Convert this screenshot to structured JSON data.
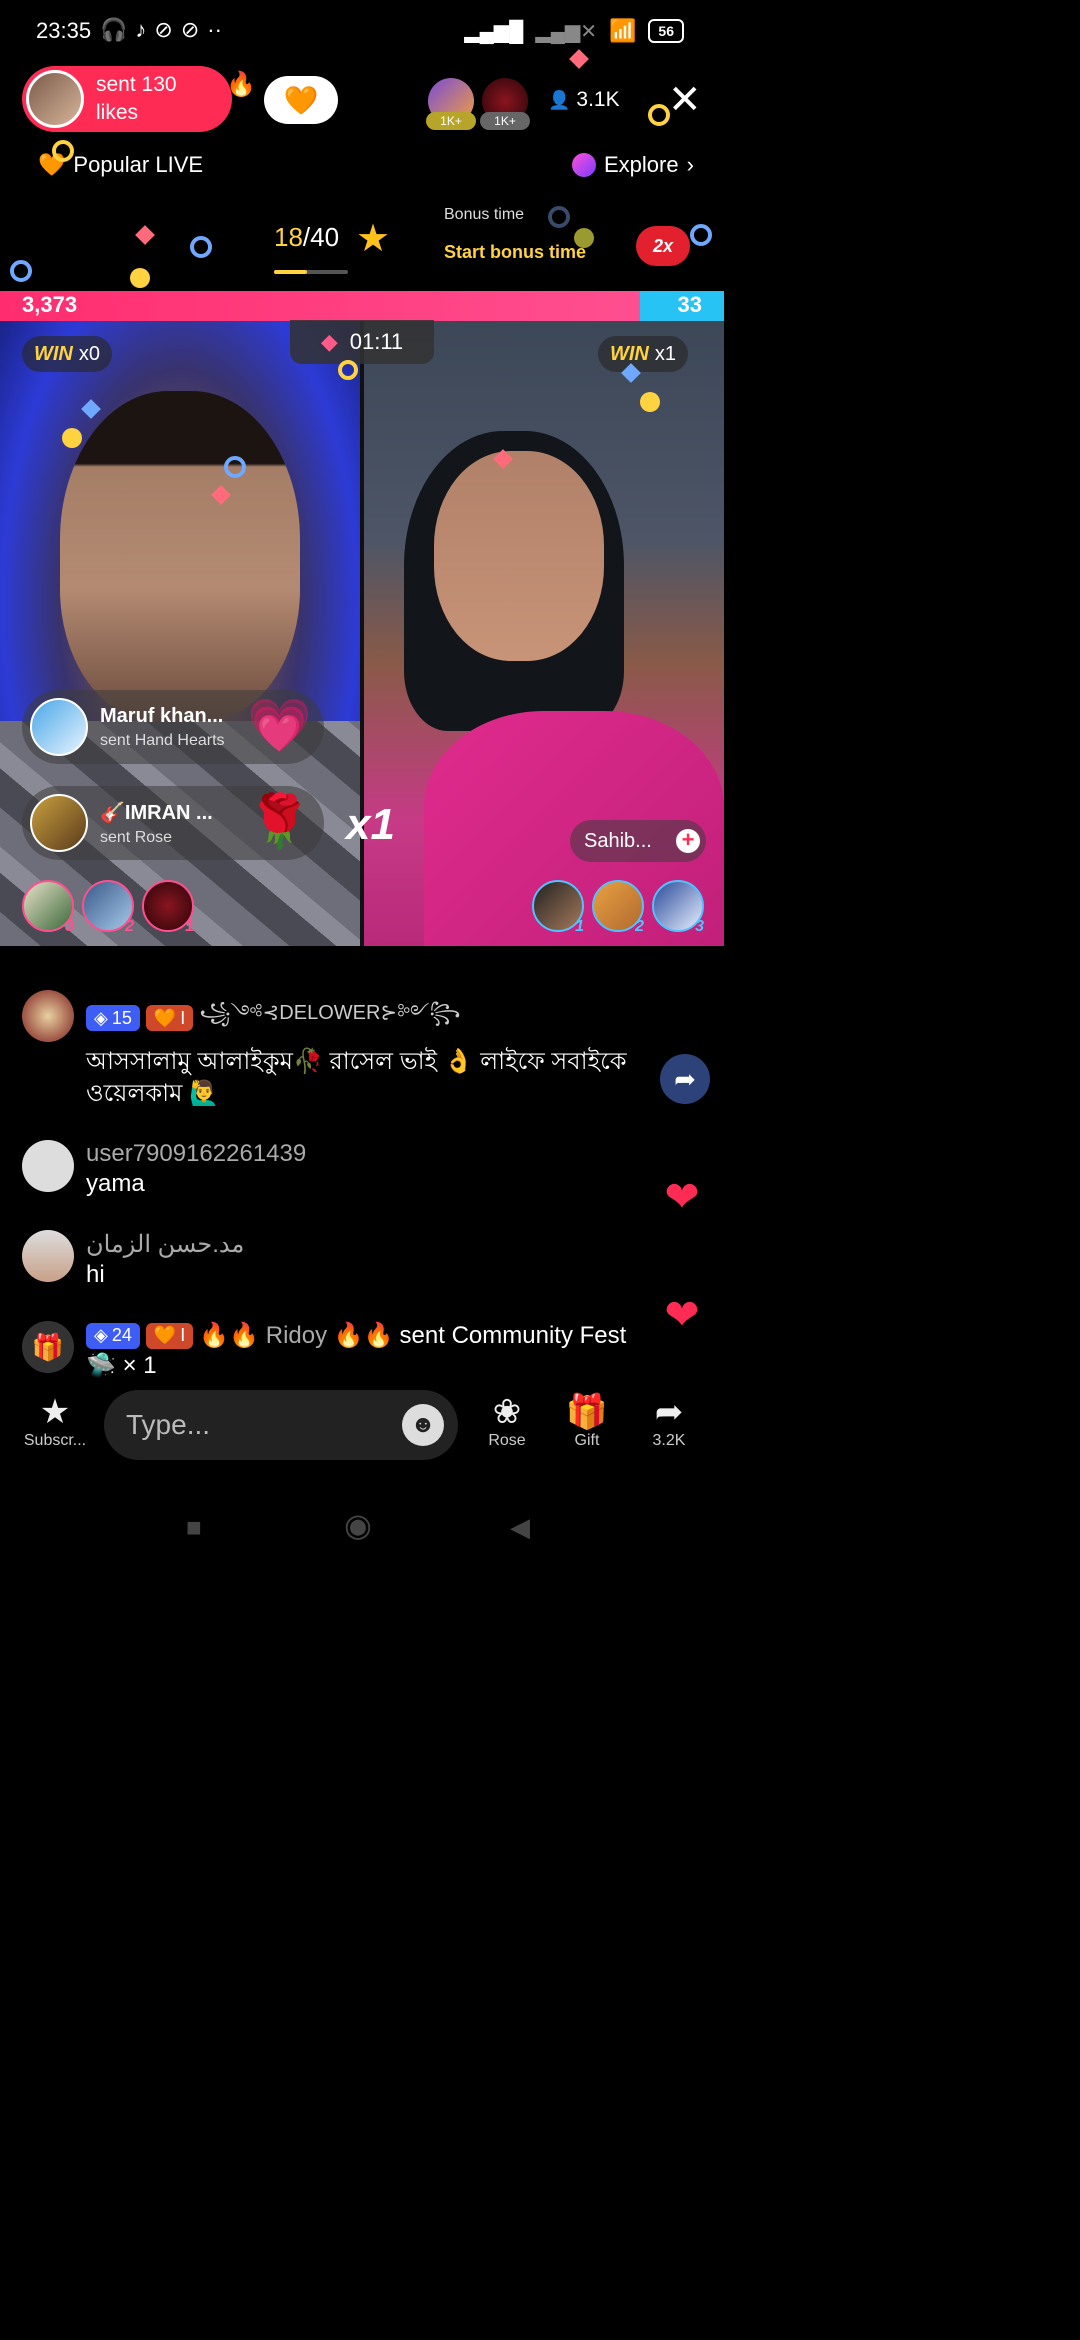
{
  "status_bar": {
    "time": "23:35",
    "left_icons": [
      "headphones-icon",
      "tiktok-icon",
      "no-sign-icon",
      "no-sign-icon",
      "more-dots-icon"
    ],
    "battery": "56"
  },
  "header": {
    "host_like_text": "sent 130 likes",
    "viewer_count": "3.1K",
    "rank_badges": [
      "1K+",
      "1K+"
    ],
    "popular_live": "Popular LIVE",
    "explore": "Explore",
    "progress_current": "18",
    "progress_total": "/40",
    "progress_fraction": 0.45,
    "bonus_label": "Bonus time",
    "bonus_start": "Start bonus time",
    "bonus_multiplier": "2x"
  },
  "battle": {
    "score_left": "3,373",
    "score_right": "33",
    "score_left_fraction": 0.99,
    "left_win": {
      "label": "WIN",
      "count": "x0"
    },
    "right_win": {
      "label": "WIN",
      "count": "x1"
    },
    "timer": "01:11",
    "combo": "x1",
    "opponent_name": "Sahib...",
    "left_gifter_ranks": [
      "3",
      "2",
      "1"
    ],
    "right_gifter_ranks": [
      "1",
      "2",
      "3"
    ]
  },
  "gift_notifications": [
    {
      "name": "Maruf khan...",
      "action": "sent Hand Hearts",
      "icon": "hand-hearts-icon"
    },
    {
      "name": "🎸IMRAN ...",
      "action": "sent Rose",
      "icon": "rose-icon"
    }
  ],
  "comments": [
    {
      "badges": [
        "15",
        "I"
      ],
      "user": "꧁༺⊰DELOWER⊱༻꧂",
      "text": "আসসালামু আলাইকুম🥀 রাসেল ভাই 👌 লাইফে সবাইকে ওয়েলকাম 🙋‍♂️"
    },
    {
      "user": "user7909162261439",
      "text": "yama"
    },
    {
      "user": "مد.حسن الزمان",
      "text": "hi"
    },
    {
      "badges": [
        "24",
        "I"
      ],
      "user": "🔥🔥 Ridoy 🔥🔥",
      "action": "sent Community Fest",
      "count": "× 1"
    }
  ],
  "bottom_bar": {
    "subscribe_label": "Subscr...",
    "input_placeholder": "Type...",
    "rose_label": "Rose",
    "gift_label": "Gift",
    "share_label": "3.2K"
  },
  "colors": {
    "accent_pink": "#fe2c55",
    "score_left": "#ff2d6f",
    "score_right": "#27c3f4",
    "gold": "#ffd23f"
  }
}
